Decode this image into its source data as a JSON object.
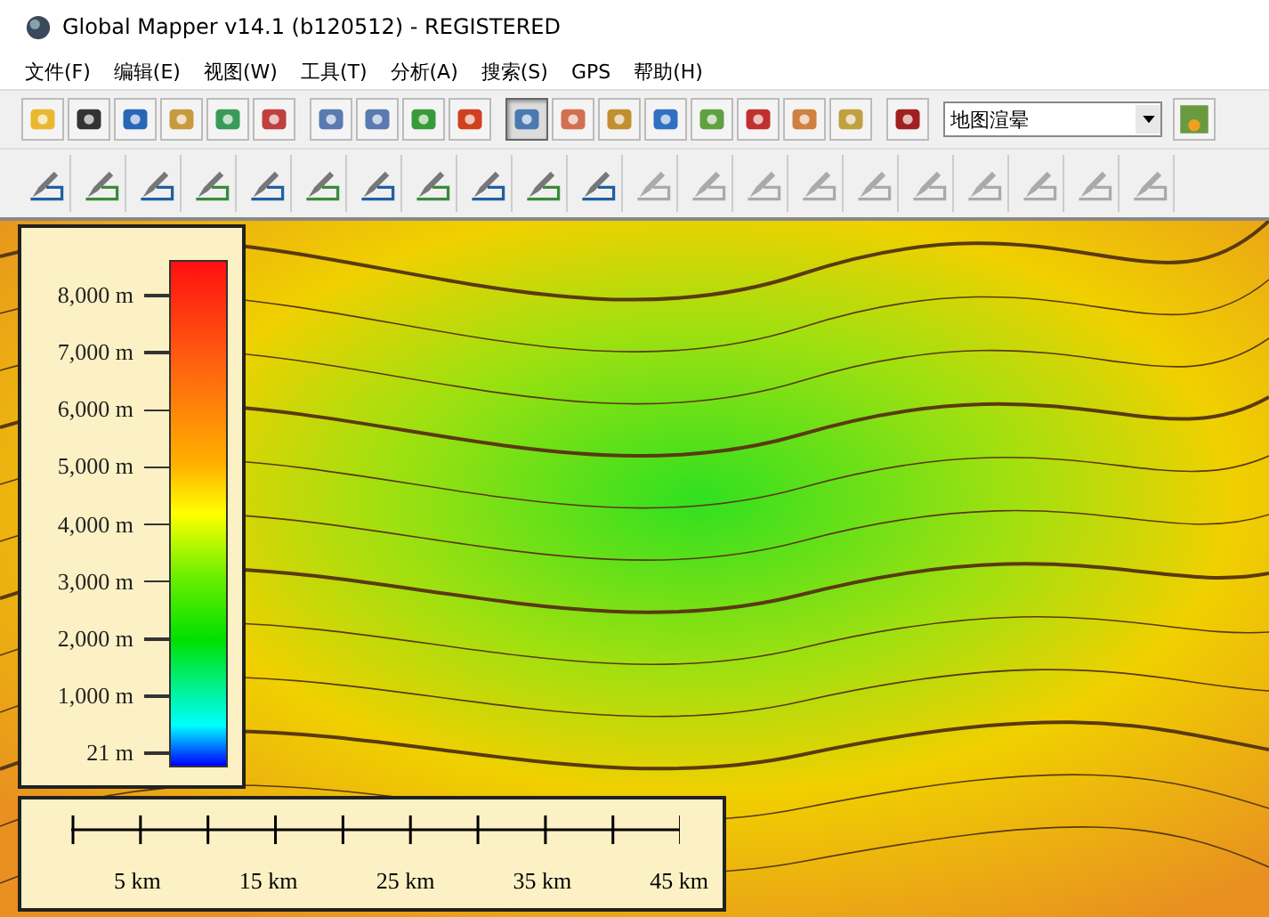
{
  "window": {
    "title": "Global Mapper v14.1 (b120512) - REGISTERED"
  },
  "menu": [
    "文件(F)",
    "编辑(E)",
    "视图(W)",
    "工具(T)",
    "分析(A)",
    "搜索(S)",
    "GPS",
    "帮助(H)"
  ],
  "toolbar_1": {
    "groups": [
      [
        {
          "selected": false
        },
        {
          "selected": false
        },
        {
          "selected": false
        },
        {
          "selected": false
        },
        {
          "selected": false
        },
        {
          "selected": false
        }
      ],
      [
        {
          "selected": false
        },
        {
          "selected": false
        },
        {
          "selected": false
        },
        {
          "selected": false
        }
      ],
      [
        {
          "selected": true
        },
        {
          "selected": false
        },
        {
          "selected": false
        },
        {
          "selected": false
        },
        {
          "selected": false
        },
        {
          "selected": false
        },
        {
          "selected": false
        },
        {
          "selected": false
        }
      ],
      [
        {
          "selected": false
        }
      ]
    ],
    "dropdown": "地图渲晕"
  },
  "toolbar_2": [
    {
      "disabled": false
    },
    {
      "disabled": false
    },
    {
      "disabled": false
    },
    {
      "disabled": false
    },
    {
      "disabled": false
    },
    {
      "disabled": false
    },
    {
      "disabled": false
    },
    {
      "disabled": false
    },
    {
      "disabled": false
    },
    {
      "disabled": false
    },
    {
      "disabled": false
    },
    {
      "disabled": true
    },
    {
      "disabled": true
    },
    {
      "disabled": true
    },
    {
      "disabled": true
    },
    {
      "disabled": true
    },
    {
      "disabled": true
    },
    {
      "disabled": true
    },
    {
      "disabled": true
    },
    {
      "disabled": true
    },
    {
      "disabled": true
    }
  ],
  "legend": {
    "labels": [
      "8,000 m",
      "7,000 m",
      "6,000 m",
      "5,000 m",
      "4,000 m",
      "3,000 m",
      "2,000 m",
      "1,000 m",
      "21 m"
    ]
  },
  "scale_bar": {
    "labels": [
      "5 km",
      "15 km",
      "25 km",
      "35 km",
      "45 km"
    ]
  }
}
